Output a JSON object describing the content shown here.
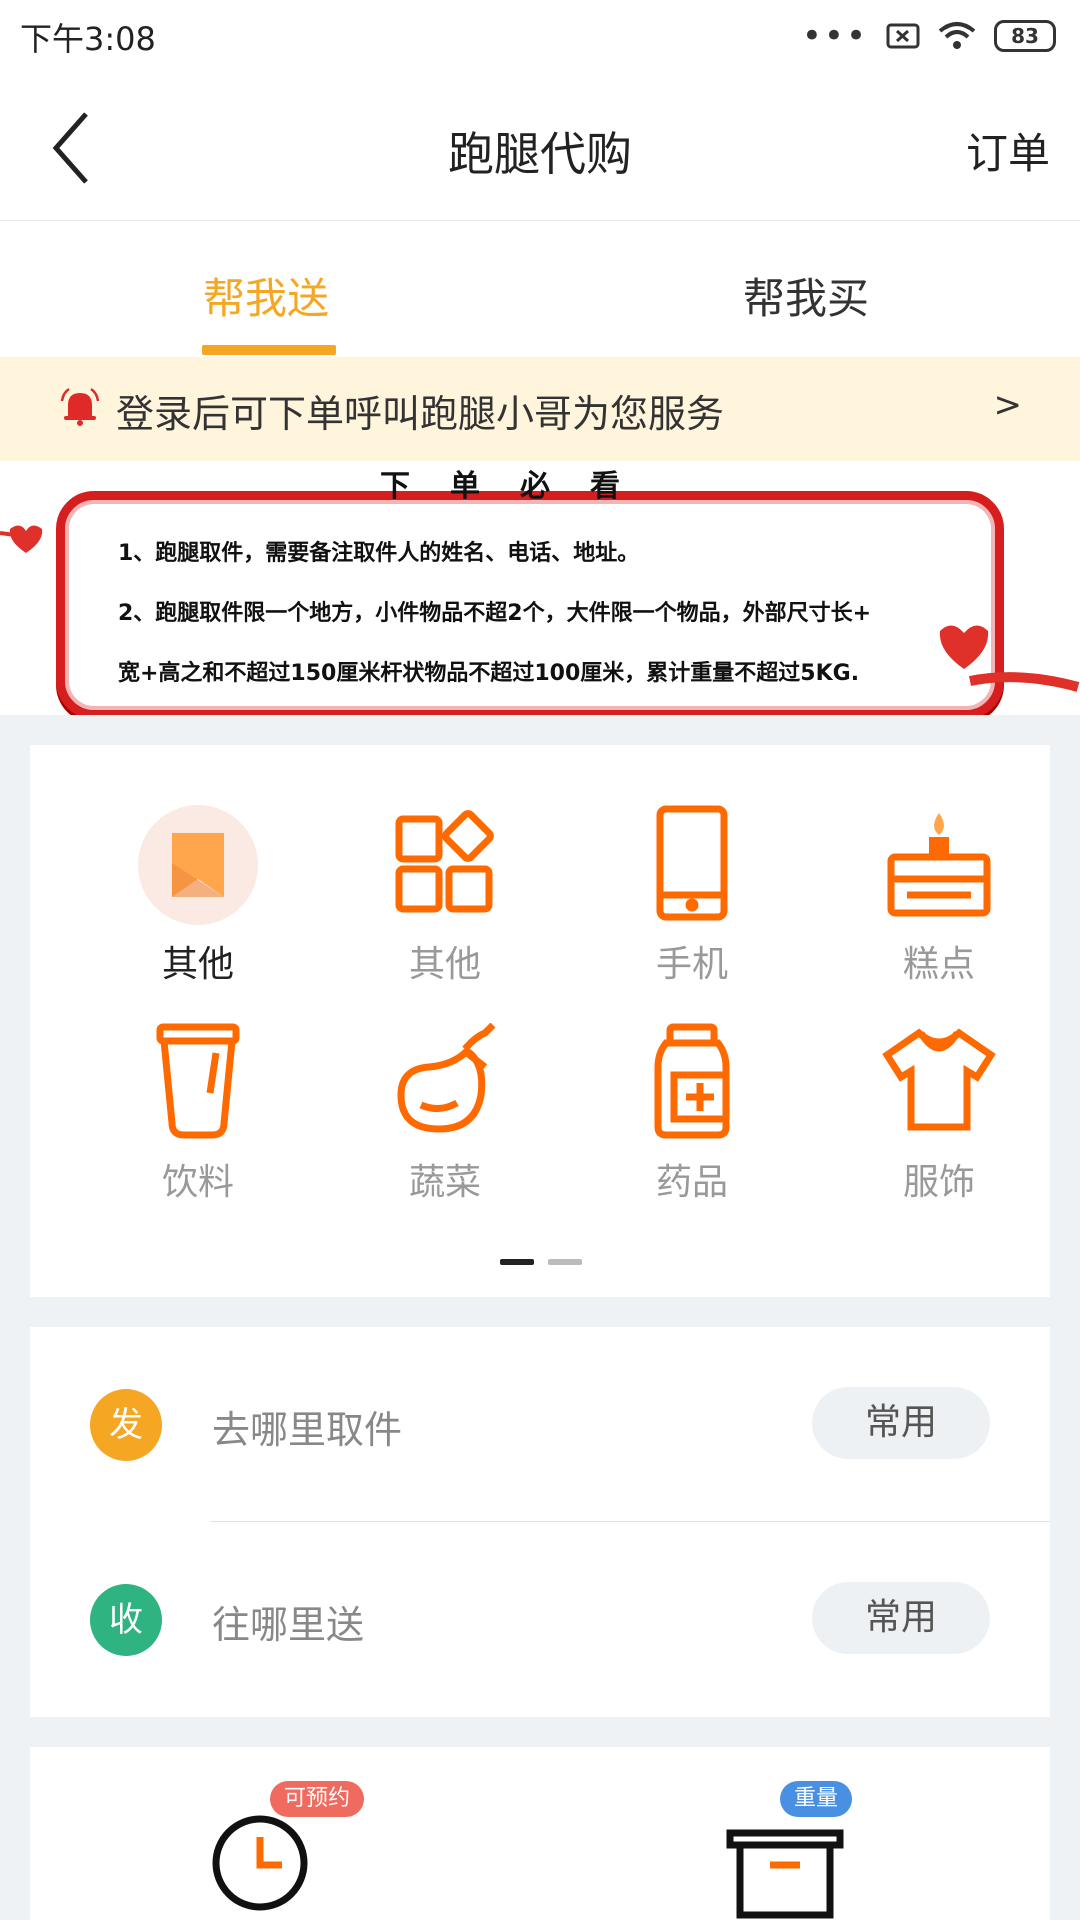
{
  "status": {
    "time": "下午3:08",
    "battery": "83"
  },
  "header": {
    "title": "跑腿代购",
    "orders_label": "订单"
  },
  "tabs": [
    {
      "label": "帮我送",
      "active": true
    },
    {
      "label": "帮我买",
      "active": false
    }
  ],
  "notice": {
    "text": "登录后可下单呼叫跑腿小哥为您服务",
    "arrow": ">"
  },
  "banner": {
    "title": "下单必看",
    "rules": [
      "1、跑腿取件，需要备注取件人的姓名、电话、地址。",
      "2、跑腿取件限一个地方，小件物品不超2个，大件限一个物品，外部尺寸长+",
      "宽+高之和不超过150厘米杆状物品不超过100厘米，累计重量不超过5KG."
    ]
  },
  "categories": [
    {
      "label": "其他",
      "icon": "bookmark-icon",
      "selected": true
    },
    {
      "label": "其他",
      "icon": "grid-icon",
      "selected": false
    },
    {
      "label": "手机",
      "icon": "phone-icon",
      "selected": false
    },
    {
      "label": "糕点",
      "icon": "cake-icon",
      "selected": false
    },
    {
      "label": "饮料",
      "icon": "cup-icon",
      "selected": false
    },
    {
      "label": "蔬菜",
      "icon": "eggplant-icon",
      "selected": false
    },
    {
      "label": "药品",
      "icon": "medicine-icon",
      "selected": false
    },
    {
      "label": "服饰",
      "icon": "shirt-icon",
      "selected": false
    }
  ],
  "address": {
    "pickup": {
      "badge": "发",
      "placeholder": "去哪里取件",
      "common_label": "常用",
      "color": "#f5a623"
    },
    "dropoff": {
      "badge": "收",
      "placeholder": "往哪里送",
      "common_label": "常用",
      "color": "#2fb380"
    }
  },
  "bottom": {
    "schedule_badge": "可预约",
    "weight_badge": "重量"
  },
  "colors": {
    "accent": "#f5a623",
    "icon_orange": "#ff6a00",
    "notice_bg": "#fff5dc"
  }
}
